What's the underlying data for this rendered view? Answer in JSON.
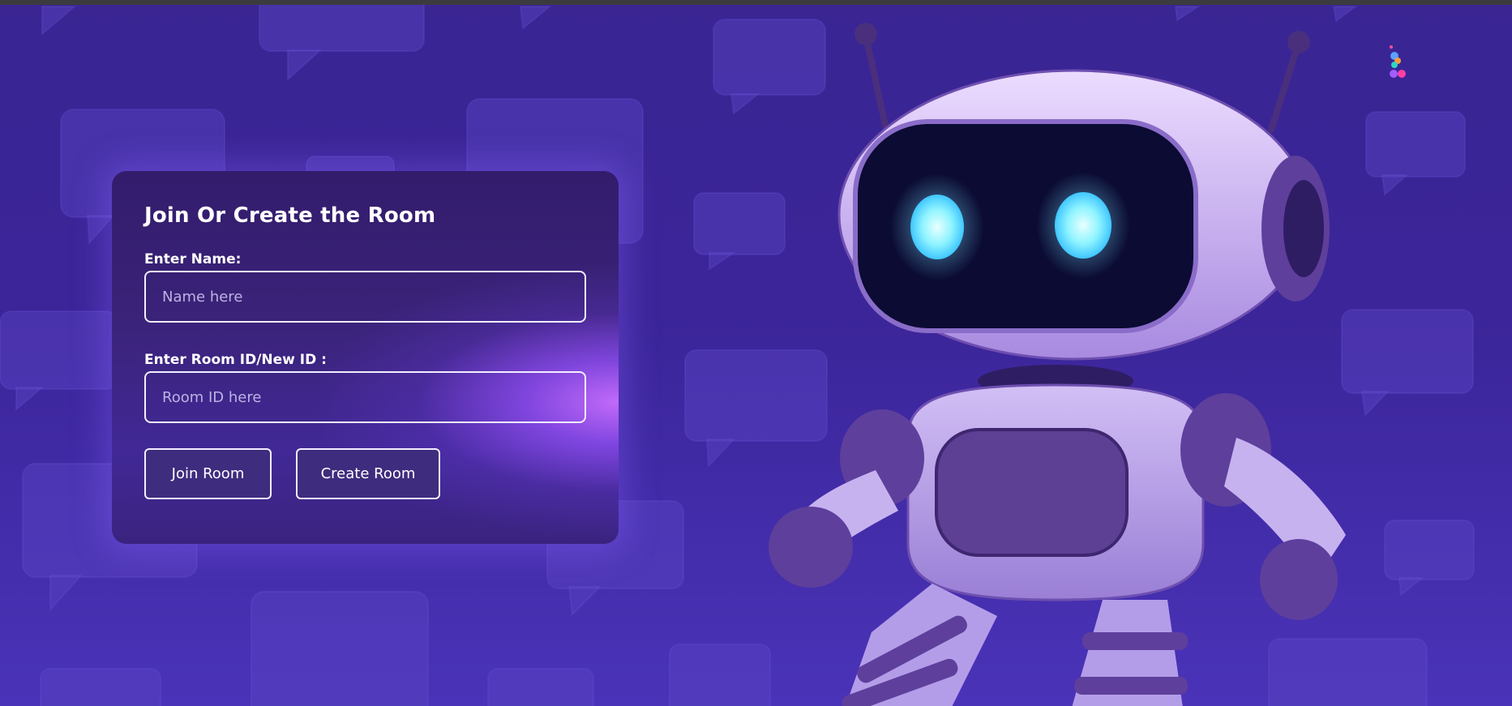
{
  "page": {
    "colors": {
      "background": "#3b2599",
      "card": "#3a2379",
      "card_glow": "#b36bff",
      "button_fill": "#3e2c7e",
      "border": "#f3eeff",
      "placeholder": "#bdb2e4",
      "robot_body": "#b9a3ec",
      "robot_visor": "#0b0b33",
      "robot_eyes": "#8ff4ff"
    }
  },
  "form": {
    "title": "Join Or Create the Room",
    "name_label": "Enter Name:",
    "name_value": "",
    "name_placeholder": "Name here",
    "room_label": "Enter Room ID/New ID :",
    "room_value": "",
    "room_placeholder": "Room ID here",
    "join_button": "Join Room",
    "create_button": "Create Room"
  },
  "illustration": {
    "subject": "robot-mascot",
    "icon": "chat-bubble-pattern"
  }
}
